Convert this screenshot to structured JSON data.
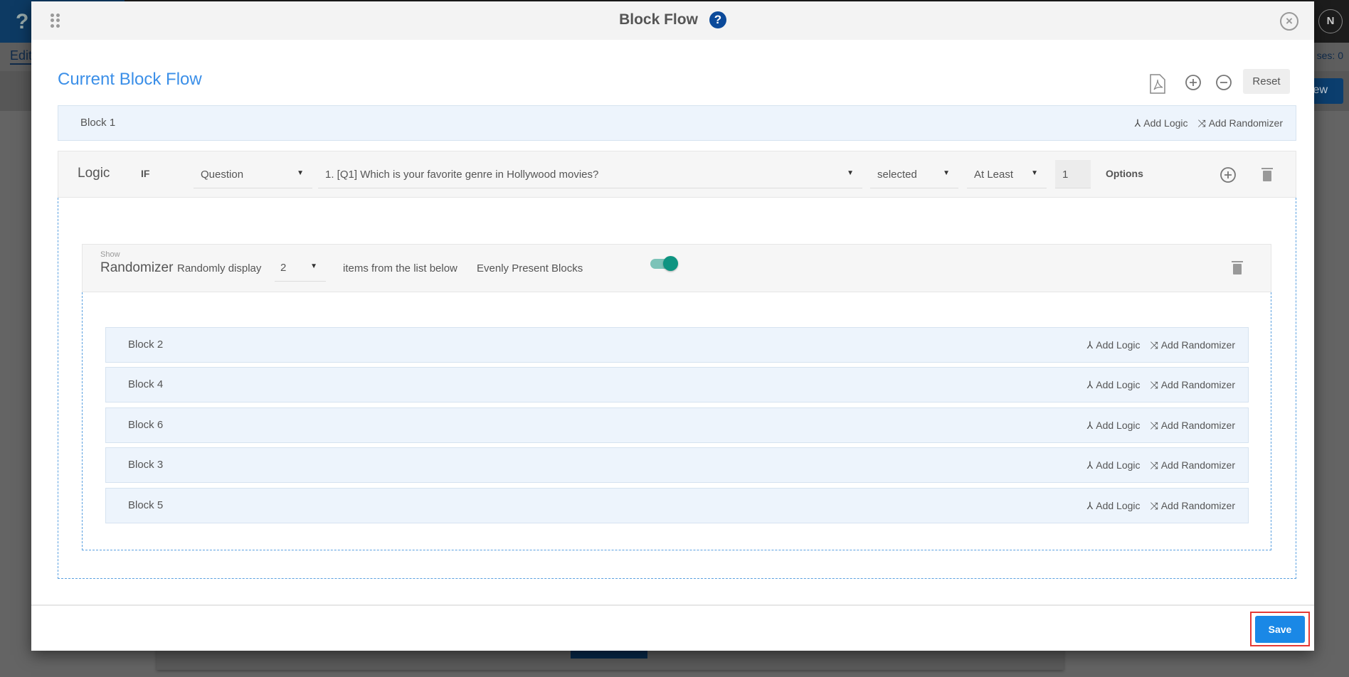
{
  "background": {
    "logo": "?",
    "edit_tab": "Edit",
    "responses": "ses: 0",
    "view_button": "view",
    "avatar": "N"
  },
  "modal": {
    "title": "Block Flow",
    "help_icon": "question-circle-icon",
    "close_icon": "close-circle-icon",
    "heading": "Current Block Flow",
    "toolbar": {
      "pdf_icon": "pdf-icon",
      "zoom_in_icon": "plus-circle-icon",
      "zoom_out_icon": "minus-circle-icon",
      "reset_label": "Reset"
    },
    "add_logic": "Add Logic",
    "add_randomizer": "Add Randomizer",
    "top_block": "Block 1",
    "logic": {
      "label": "Logic",
      "if": "IF",
      "type": "Question",
      "question": "1. [Q1] Which is your favorite genre in Hollywood movies?",
      "condition": "selected",
      "quantifier": "At Least",
      "count": "1",
      "options_label": "Options"
    },
    "randomizer": {
      "show": "Show",
      "label": "Randomizer",
      "randomly_display": "Randomly display",
      "count": "2",
      "items_text": "items from the list below",
      "evenly_label": "Evenly Present Blocks",
      "evenly_on": true,
      "blocks": [
        "Block 2",
        "Block 4",
        "Block 6",
        "Block 3",
        "Block 5"
      ]
    },
    "save_label": "Save",
    "accent_color": "#1a88e6"
  }
}
